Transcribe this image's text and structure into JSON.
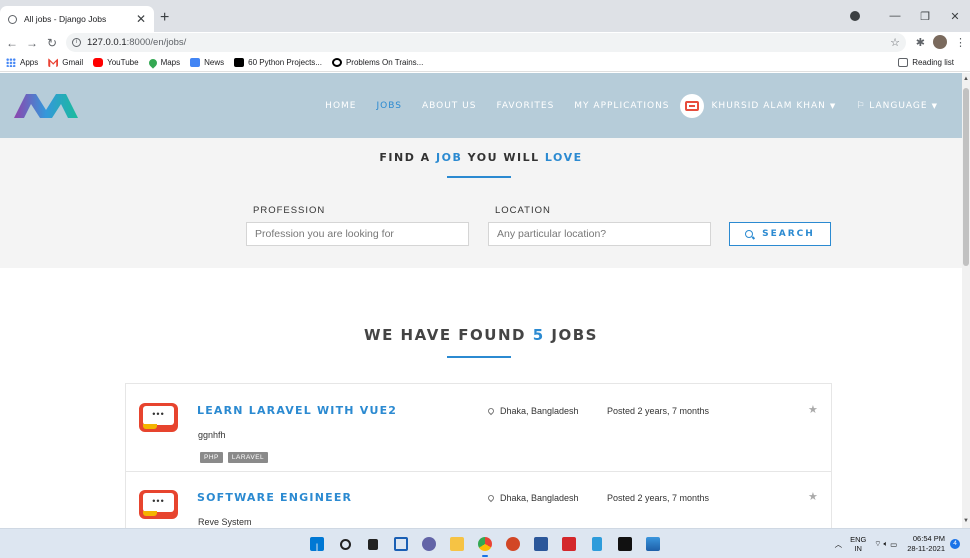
{
  "browser": {
    "tab_title": "All jobs - Django Jobs",
    "url_host": "127.0.0.1",
    "url_path": ":8000/en/jobs/",
    "bookmarks": [
      "Apps",
      "Gmail",
      "YouTube",
      "Maps",
      "News",
      "60 Python Projects...",
      "Problems On Trains..."
    ],
    "reading_list": "Reading list"
  },
  "nav": {
    "home": "HOME",
    "jobs": "JOBS",
    "about": "ABOUT US",
    "favorites": "FAVORITES",
    "applications": "MY APPLICATIONS",
    "user": "KHURSID ALAM KHAN",
    "language": "LANGUAGE"
  },
  "hero": {
    "title_1": "FIND A ",
    "title_hl1": "JOB",
    "title_2": " YOU WILL ",
    "title_hl2": "LOVE",
    "profession_label": "PROFESSION",
    "profession_placeholder": "Profession you are looking for",
    "location_label": "LOCATION",
    "location_placeholder": "Any particular location?",
    "search_label": "SEARCH"
  },
  "results": {
    "prefix": "WE HAVE FOUND ",
    "count": "5",
    "suffix": " JOBS"
  },
  "jobs": [
    {
      "title": "LEARN LARAVEL WITH VUE2",
      "company": "ggnhfh",
      "location": "Dhaka, Bangladesh",
      "posted": "Posted 2 years, 7 months",
      "tags": [
        "PHP",
        "LARAVEL"
      ]
    },
    {
      "title": "SOFTWARE ENGINEER",
      "company": "Reve System",
      "location": "Dhaka, Bangladesh",
      "posted": "Posted 2 years, 7 months",
      "tags": []
    }
  ],
  "taskbar": {
    "lang_1": "ENG",
    "lang_2": "IN",
    "time": "06:54 PM",
    "date": "28-11-2021",
    "notifications": "4"
  },
  "colors": {
    "accent": "#2b8ad1",
    "header_bg": "#b6ccd9",
    "tag_bg": "#8a8a8a"
  }
}
